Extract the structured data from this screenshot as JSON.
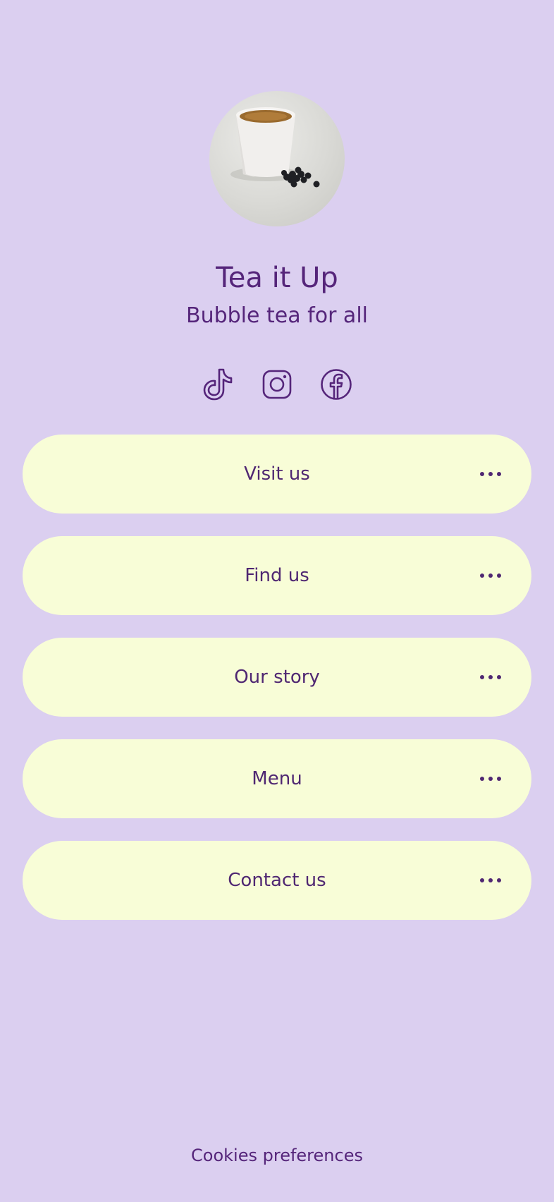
{
  "profile": {
    "title": "Tea it Up",
    "subtitle": "Bubble tea for all",
    "avatar": "tea-cup-with-tapioca-pearls-photo"
  },
  "socials": [
    {
      "icon": "tiktok-icon"
    },
    {
      "icon": "instagram-icon"
    },
    {
      "icon": "facebook-icon"
    }
  ],
  "links": [
    {
      "label": "Visit us"
    },
    {
      "label": "Find us"
    },
    {
      "label": "Our story"
    },
    {
      "label": "Menu"
    },
    {
      "label": "Contact us"
    }
  ],
  "footer": {
    "cookies": "Cookies preferences"
  },
  "colors": {
    "background": "#dbcff0",
    "button": "#f8fdd7",
    "text": "#4f2772"
  }
}
